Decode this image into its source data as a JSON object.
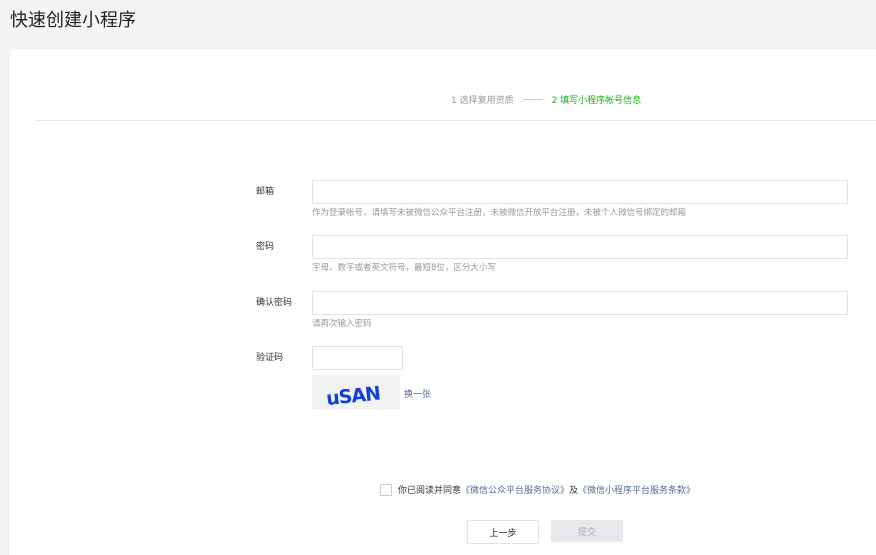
{
  "page_title": "快速创建小程序",
  "steps": [
    {
      "label": "1 选择复用资质"
    },
    {
      "label": "2 填写小程序帐号信息"
    }
  ],
  "form": {
    "email": {
      "label": "邮箱",
      "value": "",
      "tip": "作为登录帐号，请填写未被微信公众平台注册，未被微信开放平台注册，未被个人微信号绑定的邮箱"
    },
    "password": {
      "label": "密码",
      "value": "",
      "tip": "字母、数字或者英文符号，最短8位，区分大小写"
    },
    "confirm": {
      "label": "确认密码",
      "value": "",
      "tip": "请再次输入密码"
    },
    "captcha": {
      "label": "验证码",
      "value": "",
      "image_text": "uSAN",
      "swap": "换一张"
    }
  },
  "agreement": {
    "prefix": "你已阅读并同意",
    "link1": "《微信公众平台服务协议》",
    "and": "及",
    "link2": "《微信小程序平台服务条款》"
  },
  "buttons": {
    "prev": "上一步",
    "submit": "提交"
  }
}
